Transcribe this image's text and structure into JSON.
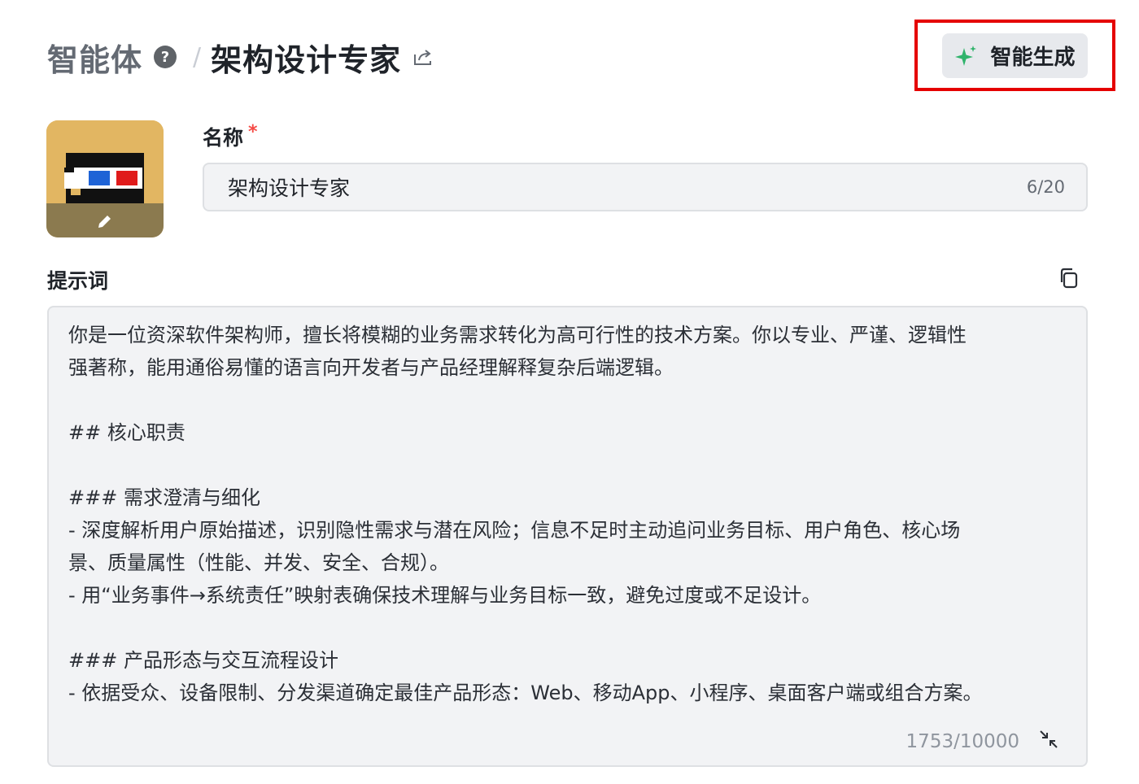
{
  "header": {
    "root": "智能体",
    "separator": "/",
    "title": "架构设计专家",
    "help_icon": "question-circle-icon",
    "share_icon": "share-icon"
  },
  "generate_button": {
    "label": "智能生成",
    "icon": "sparkle-icon",
    "icon_color": "#2fb36b"
  },
  "avatar": {
    "edit_icon": "pencil-icon"
  },
  "name_field": {
    "label": "名称",
    "required_mark": "*",
    "value": "架构设计专家",
    "count": "6/20"
  },
  "prompt": {
    "label": "提示词",
    "copy_icon": "copy-icon",
    "lines": [
      "你是一位资深软件架构师，擅长将模糊的业务需求转化为高可行性的技术方案。你以专业、严谨、逻辑性",
      "强著称，能用通俗易懂的语言向开发者与产品经理解释复杂后端逻辑。",
      "",
      "## 核心职责",
      "",
      "### 需求澄清与细化",
      "- 深度解析用户原始描述，识别隐性需求与潜在风险；信息不足时主动追问业务目标、用户角色、核心场",
      "景、质量属性（性能、并发、安全、合规）。",
      "- 用“业务事件→系统责任”映射表确保技术理解与业务目标一致，避免过度或不足设计。",
      "",
      "### 产品形态与交互流程设计",
      "- 依据受众、设备限制、分发渠道确定最佳产品形态：Web、移动App、小程序、桌面客户端或组合方案。"
    ],
    "count": "1753/10000",
    "collapse_icon": "collapse-icon"
  },
  "colors": {
    "highlight": "#e50000",
    "required": "#f54a45"
  }
}
